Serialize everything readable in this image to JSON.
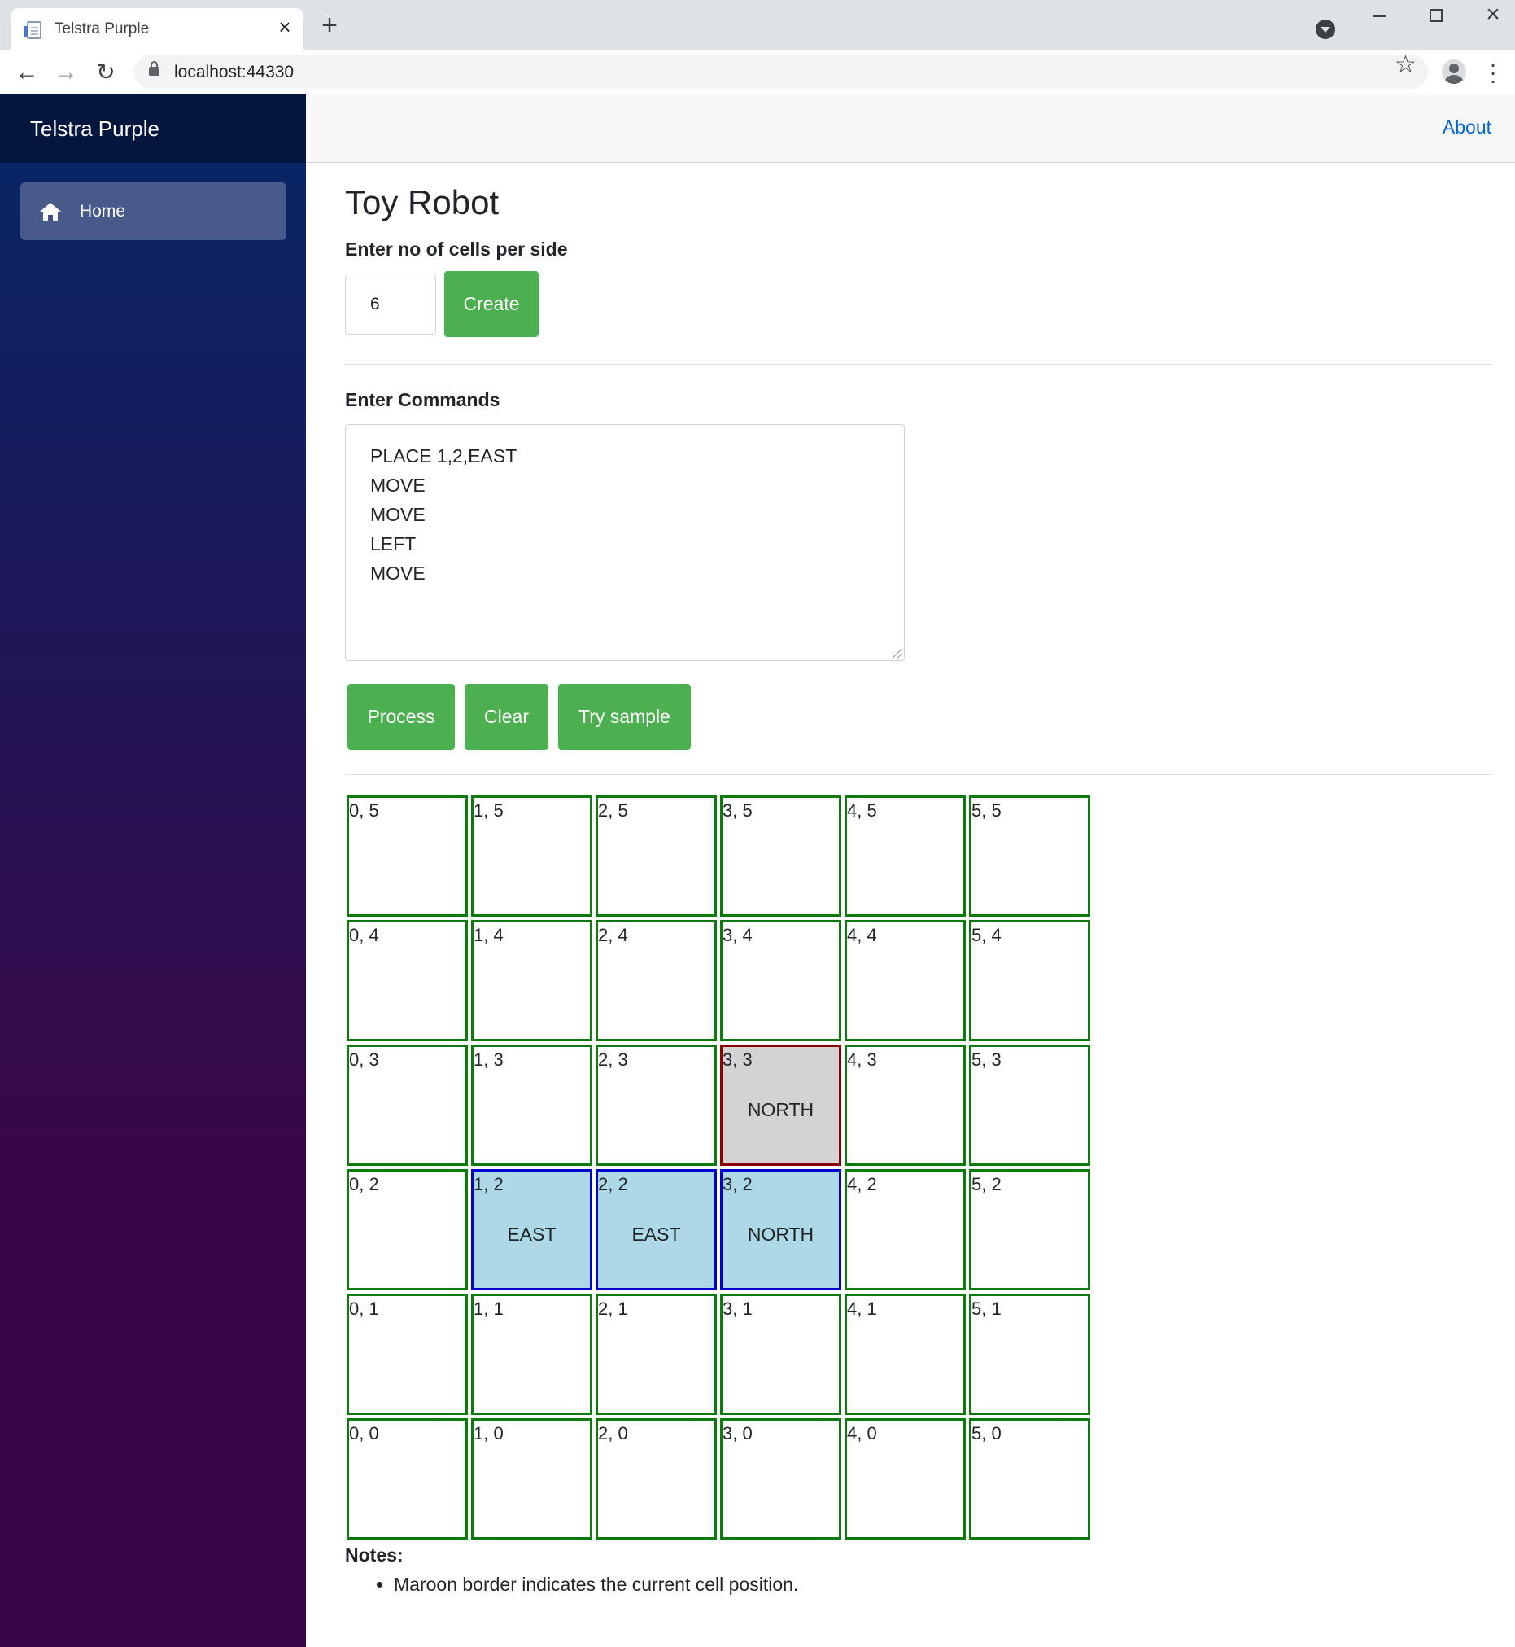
{
  "browser": {
    "tab_title": "Telstra Purple",
    "url": "localhost:44330"
  },
  "sidebar": {
    "brand": "Telstra Purple",
    "items": [
      {
        "label": "Home",
        "icon": "home-icon"
      }
    ]
  },
  "top_row": {
    "about_label": "About"
  },
  "page": {
    "title": "Toy Robot",
    "cells_label": "Enter no of cells per side",
    "cells_value": "6",
    "create_label": "Create",
    "commands_label": "Enter Commands",
    "commands": [
      "PLACE 1,2,EAST",
      "MOVE",
      "MOVE",
      "LEFT",
      "MOVE"
    ],
    "process_label": "Process",
    "clear_label": "Clear",
    "sample_label": "Try sample"
  },
  "grid": {
    "size": 6,
    "rows": [
      [
        {
          "label": "0, 5"
        },
        {
          "label": "1, 5"
        },
        {
          "label": "2, 5"
        },
        {
          "label": "3, 5"
        },
        {
          "label": "4, 5"
        },
        {
          "label": "5, 5"
        }
      ],
      [
        {
          "label": "0, 4"
        },
        {
          "label": "1, 4"
        },
        {
          "label": "2, 4"
        },
        {
          "label": "3, 4"
        },
        {
          "label": "4, 4"
        },
        {
          "label": "5, 4"
        }
      ],
      [
        {
          "label": "0, 3"
        },
        {
          "label": "1, 3"
        },
        {
          "label": "2, 3"
        },
        {
          "label": "3, 3",
          "direction": "NORTH",
          "state": "current"
        },
        {
          "label": "4, 3"
        },
        {
          "label": "5, 3"
        }
      ],
      [
        {
          "label": "0, 2"
        },
        {
          "label": "1, 2",
          "direction": "EAST",
          "state": "visited"
        },
        {
          "label": "2, 2",
          "direction": "EAST",
          "state": "visited"
        },
        {
          "label": "3, 2",
          "direction": "NORTH",
          "state": "visited"
        },
        {
          "label": "4, 2"
        },
        {
          "label": "5, 2"
        }
      ],
      [
        {
          "label": "0, 1"
        },
        {
          "label": "1, 1"
        },
        {
          "label": "2, 1"
        },
        {
          "label": "3, 1"
        },
        {
          "label": "4, 1"
        },
        {
          "label": "5, 1"
        }
      ],
      [
        {
          "label": "0, 0"
        },
        {
          "label": "1, 0"
        },
        {
          "label": "2, 0"
        },
        {
          "label": "3, 0"
        },
        {
          "label": "4, 0"
        },
        {
          "label": "5, 0"
        }
      ]
    ],
    "colors": {
      "default_border": "#0c7a0c",
      "visited_bg": "#add8e6",
      "visited_border": "#0000cc",
      "current_bg": "#d3d3d3",
      "current_border": "#8b0000"
    }
  },
  "notes": {
    "title": "Notes:",
    "items": [
      "Maroon border indicates the current cell position."
    ]
  },
  "theme": {
    "button_green": "#4caf50",
    "link_blue": "#0366d6"
  }
}
